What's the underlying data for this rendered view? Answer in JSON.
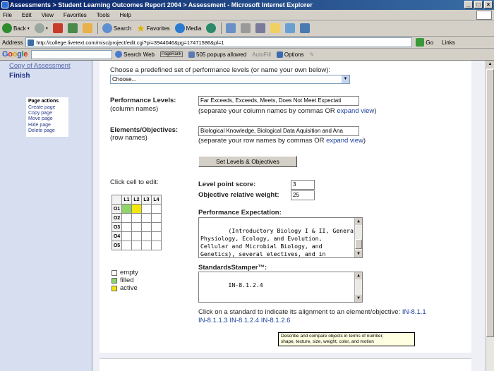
{
  "window": {
    "title": "Assessments > Student Learning Outcomes Report 2004 > Assessment - Microsoft Internet Explorer",
    "min": "_",
    "max": "□",
    "close": "×"
  },
  "menu": [
    "File",
    "Edit",
    "View",
    "Favorites",
    "Tools",
    "Help"
  ],
  "toolbar": {
    "back": "Back",
    "search": "Search",
    "favorites": "Favorites",
    "media": "Media"
  },
  "address": {
    "label": "Address",
    "url": "http://college.livetext.com/misc/project/edit.cgi?pi=3944046&pg=17471586&pl=1",
    "go": "Go",
    "links": "Links"
  },
  "google": {
    "logo": [
      "G",
      "o",
      "o",
      "g",
      "l",
      "e"
    ],
    "search_web": "Search Web",
    "pagerank": "PageRank",
    "popups": "505 popups allowed",
    "autofill": "AutoFill",
    "options": "Options"
  },
  "nav": {
    "copy": "Copy of Assessment",
    "finish": "Finish",
    "page_actions_heading": "Page actions",
    "page_actions": [
      "Create page",
      "Copy page",
      "Move page",
      "Hide page",
      "Delete page"
    ]
  },
  "form": {
    "choose_label": "Choose a predefined set of performance levels (or name your own below):",
    "choose_value": "Choose...",
    "levels_label": "Performance Levels:",
    "levels_sub": "(column names)",
    "levels_value": "Far Exceeds, Exceeds, Meets, Does Not Meet Expectati",
    "levels_help_pre": "(separate your column names by commas OR ",
    "levels_help_link": "expand view",
    "levels_help_post": ")",
    "elements_label": "Elements/Objectives:",
    "elements_sub": "(row names)",
    "elements_value": "Biological Knowledge, Biological Data Aquisition and Ana",
    "elements_help_pre": "(separate your row names by commas OR ",
    "elements_help_link": "expand view",
    "elements_help_post": ")",
    "set_button": "Set Levels & Objectives",
    "click_cell": "Click cell to edit:",
    "level_point_label": "Level point score:",
    "level_point_value": "3",
    "objective_weight_label": "Objective relative weight:",
    "objective_weight_value": "25",
    "perf_expectation_label": "Performance Expectation:",
    "perf_expectation_text": "(Introductory Biology I & II, General\nPhysiology, Ecology, and Evolution,\nCellular and Microbial Biology, and\nGenetics), several electives, and in\nchemistry, mathematics, and physics.",
    "stamper_label": "StandardsStamper™:",
    "stamper_text": "IN-8.1.2.4",
    "click_standard_pre": "Click on a standard to indicate its alignment to an element/objective: ",
    "standards": [
      "IN-8.1.1",
      "IN-8.1.1.3",
      "IN-8.1.2.4",
      "IN-8.1.2.6"
    ],
    "tooltip": "Describe and compare objects in terms of number,\nshape, texture, size, weight, color, and motion",
    "grid": {
      "cols": [
        "L1",
        "L2",
        "L3",
        "L4"
      ],
      "rows": [
        "O1",
        "O2",
        "O3",
        "O4",
        "O5"
      ]
    },
    "legend": [
      "empty",
      "filled",
      "active"
    ],
    "colors": {
      "empty": "#ffffff",
      "filled": "#8fd46a",
      "active": "#f2e60a"
    }
  }
}
